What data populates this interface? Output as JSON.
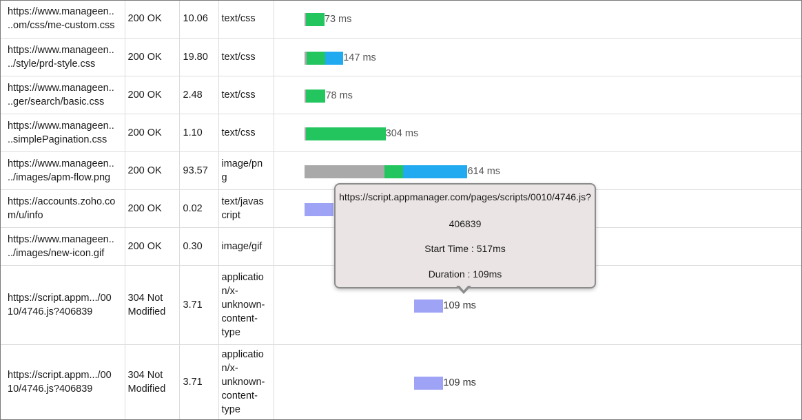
{
  "rows": [
    {
      "url": "https://www.manageen..\n..om/css/me-custom.css",
      "status": "200 OK",
      "time": "10.06",
      "type": "text/css",
      "label": "73 ms",
      "segments": [
        {
          "kind": "gray",
          "ms": 2
        },
        {
          "kind": "green",
          "ms": 71
        }
      ]
    },
    {
      "url": "https://www.manageen..\n../style/prd-style.css",
      "status": "200 OK",
      "time": "19.80",
      "type": "text/css",
      "label": "147 ms",
      "segments": [
        {
          "kind": "gray",
          "ms": 10
        },
        {
          "kind": "green",
          "ms": 70
        },
        {
          "kind": "blue",
          "ms": 67
        }
      ]
    },
    {
      "url": "https://www.manageen..\n..ger/search/basic.css",
      "status": "200 OK",
      "time": "2.48",
      "type": "text/css",
      "label": "78 ms",
      "segments": [
        {
          "kind": "gray",
          "ms": 3
        },
        {
          "kind": "green",
          "ms": 75
        }
      ]
    },
    {
      "url": "https://www.manageen..\n..simplePagination.css",
      "status": "200 OK",
      "time": "1.10",
      "type": "text/css",
      "label": "304 ms",
      "segments": [
        {
          "kind": "gray",
          "ms": 3
        },
        {
          "kind": "green",
          "ms": 301
        }
      ]
    },
    {
      "url": "https://www.manageen..\n../images/apm-flow.png",
      "status": "200 OK",
      "time": "93.57",
      "type": "image/pn\ng",
      "label": "614 ms",
      "segments": [
        {
          "kind": "gray",
          "ms": 302
        },
        {
          "kind": "green",
          "ms": 70
        },
        {
          "kind": "blue",
          "ms": 242
        }
      ]
    },
    {
      "url": "https://accounts.zoho.co\nm/u/info",
      "status": "200 OK",
      "time": "0.02",
      "type": "text/javas\ncript",
      "label": "",
      "segments": [
        {
          "kind": "purple",
          "ms": 110
        }
      ]
    },
    {
      "url": "https://www.manageen..\n../images/new-icon.gif",
      "status": "200 OK",
      "time": "0.30",
      "type": "image/gif",
      "label": "",
      "segments": []
    },
    {
      "url": "https://script.appm.../00\n10/4746.js?406839",
      "status": "304 Not\nModified",
      "time": "3.71",
      "type": "applicatio\nn/x-\nunknown-\ncontent-\ntype",
      "label": "109 ms",
      "segments": [
        {
          "kind": "purple",
          "ms": 109,
          "start": 414
        }
      ]
    },
    {
      "url": "https://script.appm.../00\n10/4746.js?406839",
      "status": "304 Not\nModified",
      "time": "3.71",
      "type": "applicatio\nn/x-\nunknown-\ncontent-\ntype",
      "label": "109 ms",
      "segments": [
        {
          "kind": "purple",
          "ms": 109,
          "start": 414
        }
      ]
    }
  ],
  "tooltip": {
    "url": "https://script.appmanager.com/pages/scripts/0010/4746.js?",
    "id": "406839",
    "start": "Start Time : 517ms",
    "duration": "Duration : 109ms"
  },
  "colors": {
    "gray": "#a9a9a9",
    "green": "#22c55e",
    "blue": "#22aaf0",
    "purple": "#9ea3f5"
  }
}
